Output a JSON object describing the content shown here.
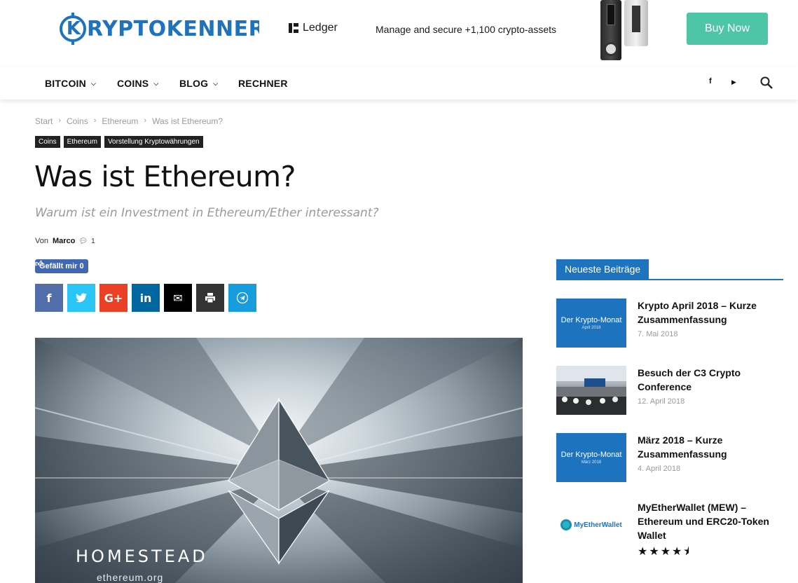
{
  "brand": {
    "logo_letter": "K",
    "logo_text": "RYPTOKENNER",
    "color": "#1e73be"
  },
  "ad": {
    "advertiser": "Ledger",
    "tagline": "Manage and secure +1,100 crypto-assets",
    "cta": "Buy Now",
    "cta_color": "#4ec5a7"
  },
  "nav": {
    "items": [
      {
        "label": "BITCOIN",
        "dropdown": true
      },
      {
        "label": "COINS",
        "dropdown": true
      },
      {
        "label": "BLOG",
        "dropdown": true
      },
      {
        "label": "RECHNER",
        "dropdown": false
      }
    ],
    "social": {
      "facebook": "f",
      "youtube": "▶"
    },
    "search_icon": "search-icon"
  },
  "breadcrumb": [
    "Start",
    "Coins",
    "Ethereum",
    "Was ist Ethereum?"
  ],
  "tags": [
    "Coins",
    "Ethereum",
    "Vorstellung Kryptowährungen"
  ],
  "article": {
    "title": "Was ist Ethereum?",
    "subtitle": "Warum ist ein Investment in Ethereum/Ether interessant?",
    "by_label": "Von",
    "author": "Marco",
    "comments": "1",
    "like_label": "Gefällt mir",
    "like_count": "0",
    "share": [
      {
        "name": "facebook",
        "glyph": "f",
        "color": "#516eab"
      },
      {
        "name": "twitter",
        "glyph": "✒",
        "color": "#29c5f6"
      },
      {
        "name": "googleplus",
        "glyph": "G+",
        "color": "#eb4026"
      },
      {
        "name": "linkedin",
        "glyph": "in",
        "color": "#0266a0"
      },
      {
        "name": "email",
        "glyph": "✉",
        "color": "#000000"
      },
      {
        "name": "print",
        "glyph": "⎙",
        "color": "#333333"
      },
      {
        "name": "telegram",
        "glyph": "➤",
        "color": "#179cde"
      }
    ],
    "hero_word": "HOMESTEAD",
    "hero_url": "ethereum.org"
  },
  "sidebar": {
    "heading": "Neueste Beiträge",
    "posts": [
      {
        "title": "Krypto April 2018 – Kurze Zusammenfassung",
        "date": "7. Mai 2018",
        "thumb": "Der Krypto-Monat",
        "thumb_sub": "April 2018"
      },
      {
        "title": "Besuch der C3 Crypto Conference",
        "date": "12. April 2018"
      },
      {
        "title": "März 2018 – Kurze Zusammenfassung",
        "date": "4. April 2018",
        "thumb": "Der Krypto-Monat",
        "thumb_sub": "März 2018"
      },
      {
        "title": "MyEtherWallet (MEW) – Ethereum und ERC20-Token Wallet",
        "thumb": "MyEtherWallet",
        "rating": 4.5,
        "rating_stars": "★★★★⯨"
      }
    ]
  }
}
